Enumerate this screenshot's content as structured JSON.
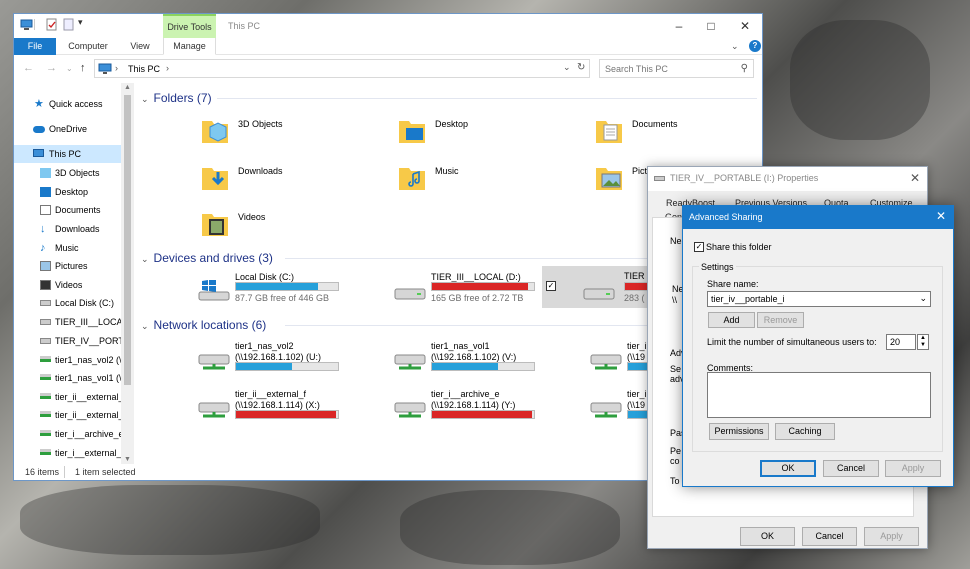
{
  "explorer": {
    "drive_tools_tab": "Drive Tools",
    "title": "This PC",
    "ribbon_tabs": {
      "file": "File",
      "computer": "Computer",
      "view": "View",
      "manage": "Manage"
    },
    "address": {
      "path": "This PC",
      "separator": ">"
    },
    "search_placeholder": "Search This PC",
    "nav": [
      {
        "label": "Quick access",
        "icon": "star-icon"
      },
      {
        "label": "OneDrive",
        "icon": "cloud-icon"
      },
      {
        "label": "This PC",
        "icon": "computer-icon"
      },
      {
        "label": "3D Objects",
        "icon": "cube-folder-icon"
      },
      {
        "label": "Desktop",
        "icon": "desktop-folder-icon"
      },
      {
        "label": "Documents",
        "icon": "documents-icon"
      },
      {
        "label": "Downloads",
        "icon": "download-arrow-icon"
      },
      {
        "label": "Music",
        "icon": "music-note-icon"
      },
      {
        "label": "Pictures",
        "icon": "pictures-icon"
      },
      {
        "label": "Videos",
        "icon": "videos-icon"
      },
      {
        "label": "Local Disk (C:)",
        "icon": "drive-icon"
      },
      {
        "label": "TIER_III__LOCAL",
        "icon": "drive-icon"
      },
      {
        "label": "TIER_IV__PORTAL",
        "icon": "drive-icon"
      },
      {
        "label": "tier1_nas_vol2 (\\\\",
        "icon": "network-drive-icon"
      },
      {
        "label": "tier1_nas_vol1 (\\\\",
        "icon": "network-drive-icon"
      },
      {
        "label": "tier_ii__external_d",
        "icon": "network-drive-icon"
      },
      {
        "label": "tier_ii__external_f",
        "icon": "network-drive-icon"
      },
      {
        "label": "tier_i__archive_e",
        "icon": "network-drive-icon"
      },
      {
        "label": "tier_i__external_c",
        "icon": "network-drive-icon"
      }
    ],
    "groups": {
      "folders": "Folders (7)",
      "devices": "Devices and drives (3)",
      "network": "Network locations (6)"
    },
    "folders": [
      {
        "label": "3D Objects",
        "icon": "3d-objects-folder-icon"
      },
      {
        "label": "Desktop",
        "icon": "desktop-folder-icon"
      },
      {
        "label": "Documents",
        "icon": "documents-folder-icon"
      },
      {
        "label": "Downloads",
        "icon": "downloads-folder-icon"
      },
      {
        "label": "Music",
        "icon": "music-folder-icon"
      },
      {
        "label": "Pictu",
        "icon": "pictures-folder-icon"
      },
      {
        "label": "Videos",
        "icon": "videos-folder-icon"
      }
    ],
    "drives": [
      {
        "name": "Local Disk (C:)",
        "free": "87.7 GB free of 446 GB",
        "used_fraction": 0.8,
        "color": "#26a0da"
      },
      {
        "name": "TIER_III__LOCAL (D:)",
        "free": "165 GB free of 2.72 TB",
        "used_fraction": 0.94,
        "color": "#da2626"
      },
      {
        "name": "TIER",
        "free": "283 (",
        "used_fraction": 0.95,
        "color": "#da2626"
      }
    ],
    "network": [
      {
        "name": "tier1_nas_vol2",
        "path": "(\\\\192.168.1.102) (U:)",
        "used_fraction": 0.55,
        "color": "#26a0da"
      },
      {
        "name": "tier1_nas_vol1",
        "path": "(\\\\192.168.1.102) (V:)",
        "used_fraction": 0.65,
        "color": "#26a0da"
      },
      {
        "name": "tier_i",
        "path": "(\\\\19",
        "used_fraction": 1.0,
        "color": "#26a0da"
      },
      {
        "name": "tier_ii__external_f",
        "path": "(\\\\192.168.1.114) (X:)",
        "used_fraction": 0.98,
        "color": "#da2626"
      },
      {
        "name": "tier_i__archive_e",
        "path": "(\\\\192.168.1.114) (Y:)",
        "used_fraction": 0.98,
        "color": "#da2626"
      },
      {
        "name": "tier_i",
        "path": "(\\\\19",
        "used_fraction": 1.0,
        "color": "#26a0da"
      }
    ],
    "status": {
      "items": "16 items",
      "selected": "1 item selected"
    }
  },
  "properties": {
    "title": "TIER_IV__PORTABLE (I:) Properties",
    "tabs": [
      "ReadyBoost",
      "Previous Versions",
      "Quota",
      "Customize",
      "Gen"
    ],
    "partial_labels": [
      "Ne",
      "Ne",
      "\\\\",
      "Adv",
      "Se",
      "adv",
      "Pas",
      "Pe",
      "co",
      "To"
    ],
    "buttons": {
      "ok": "OK",
      "cancel": "Cancel",
      "apply": "Apply"
    }
  },
  "advanced_sharing": {
    "title": "Advanced Sharing",
    "share_checkbox": "Share this folder",
    "share_checked": true,
    "settings_legend": "Settings",
    "share_name_label": "Share name:",
    "share_name_value": "tier_iv__portable_i",
    "add": "Add",
    "remove": "Remove",
    "limit_label": "Limit the number of simultaneous users to:",
    "limit_value": "20",
    "comments_label": "Comments:",
    "permissions": "Permissions",
    "caching": "Caching",
    "ok": "OK",
    "cancel": "Cancel",
    "apply": "Apply"
  },
  "colors": {
    "accent": "#1979ca",
    "drive_ok": "#26a0da",
    "drive_full": "#da2626",
    "folder": "#f7c948"
  }
}
